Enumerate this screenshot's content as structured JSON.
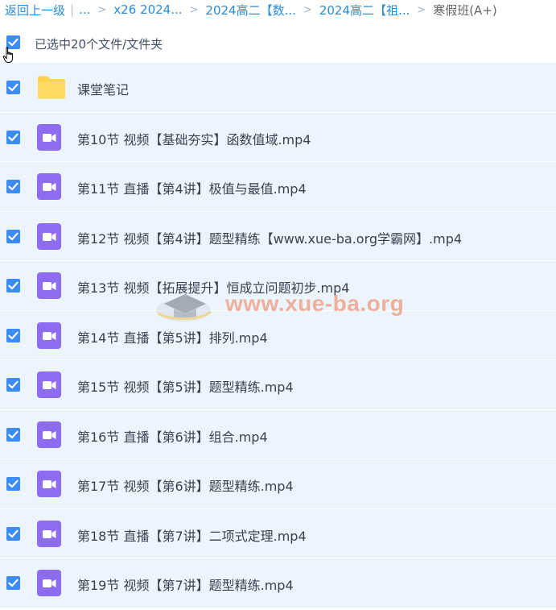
{
  "breadcrumb": {
    "back": "返回上一级",
    "separator": "|",
    "ellipsis": "...",
    "chevron": ">",
    "crumbs": [
      "x26 2024...",
      "2024高二【数...",
      "2024高二【祖..."
    ],
    "current": "寒假班(A+)"
  },
  "selection": {
    "label": "已选中20个文件/文件夹",
    "checked": true
  },
  "files": [
    {
      "name": "课堂笔记",
      "type": "folder",
      "icon": "folder-icon"
    },
    {
      "name": "第10节 视频【基础夯实】函数值域.mp4",
      "type": "video",
      "icon": "video-file-icon"
    },
    {
      "name": "第11节 直播【第4讲】极值与最值.mp4",
      "type": "video",
      "icon": "video-file-icon"
    },
    {
      "name": "第12节 视频【第4讲】题型精练【www.xue-ba.org学霸网】.mp4",
      "type": "video",
      "icon": "video-file-icon"
    },
    {
      "name": "第13节 视频【拓展提升】恒成立问题初步.mp4",
      "type": "video",
      "icon": "video-file-icon"
    },
    {
      "name": "第14节 直播【第5讲】排列.mp4",
      "type": "video",
      "icon": "video-file-icon"
    },
    {
      "name": "第15节 视频【第5讲】题型精练.mp4",
      "type": "video",
      "icon": "video-file-icon"
    },
    {
      "name": "第16节 直播【第6讲】组合.mp4",
      "type": "video",
      "icon": "video-file-icon"
    },
    {
      "name": "第17节 视频【第6讲】题型精练.mp4",
      "type": "video",
      "icon": "video-file-icon"
    },
    {
      "name": "第18节 直播【第7讲】二项式定理.mp4",
      "type": "video",
      "icon": "video-file-icon"
    },
    {
      "name": "第19节 视频【第7讲】题型精练.mp4",
      "type": "video",
      "icon": "video-file-icon"
    }
  ],
  "watermark": {
    "text": "www.xue-ba.org"
  },
  "colors": {
    "link": "#2a8bd8",
    "checkbox": "#3b8cf5",
    "row_bg": "#ecf4fd",
    "folder": "#ffd34d",
    "video_icon": "#8d6cf0"
  }
}
